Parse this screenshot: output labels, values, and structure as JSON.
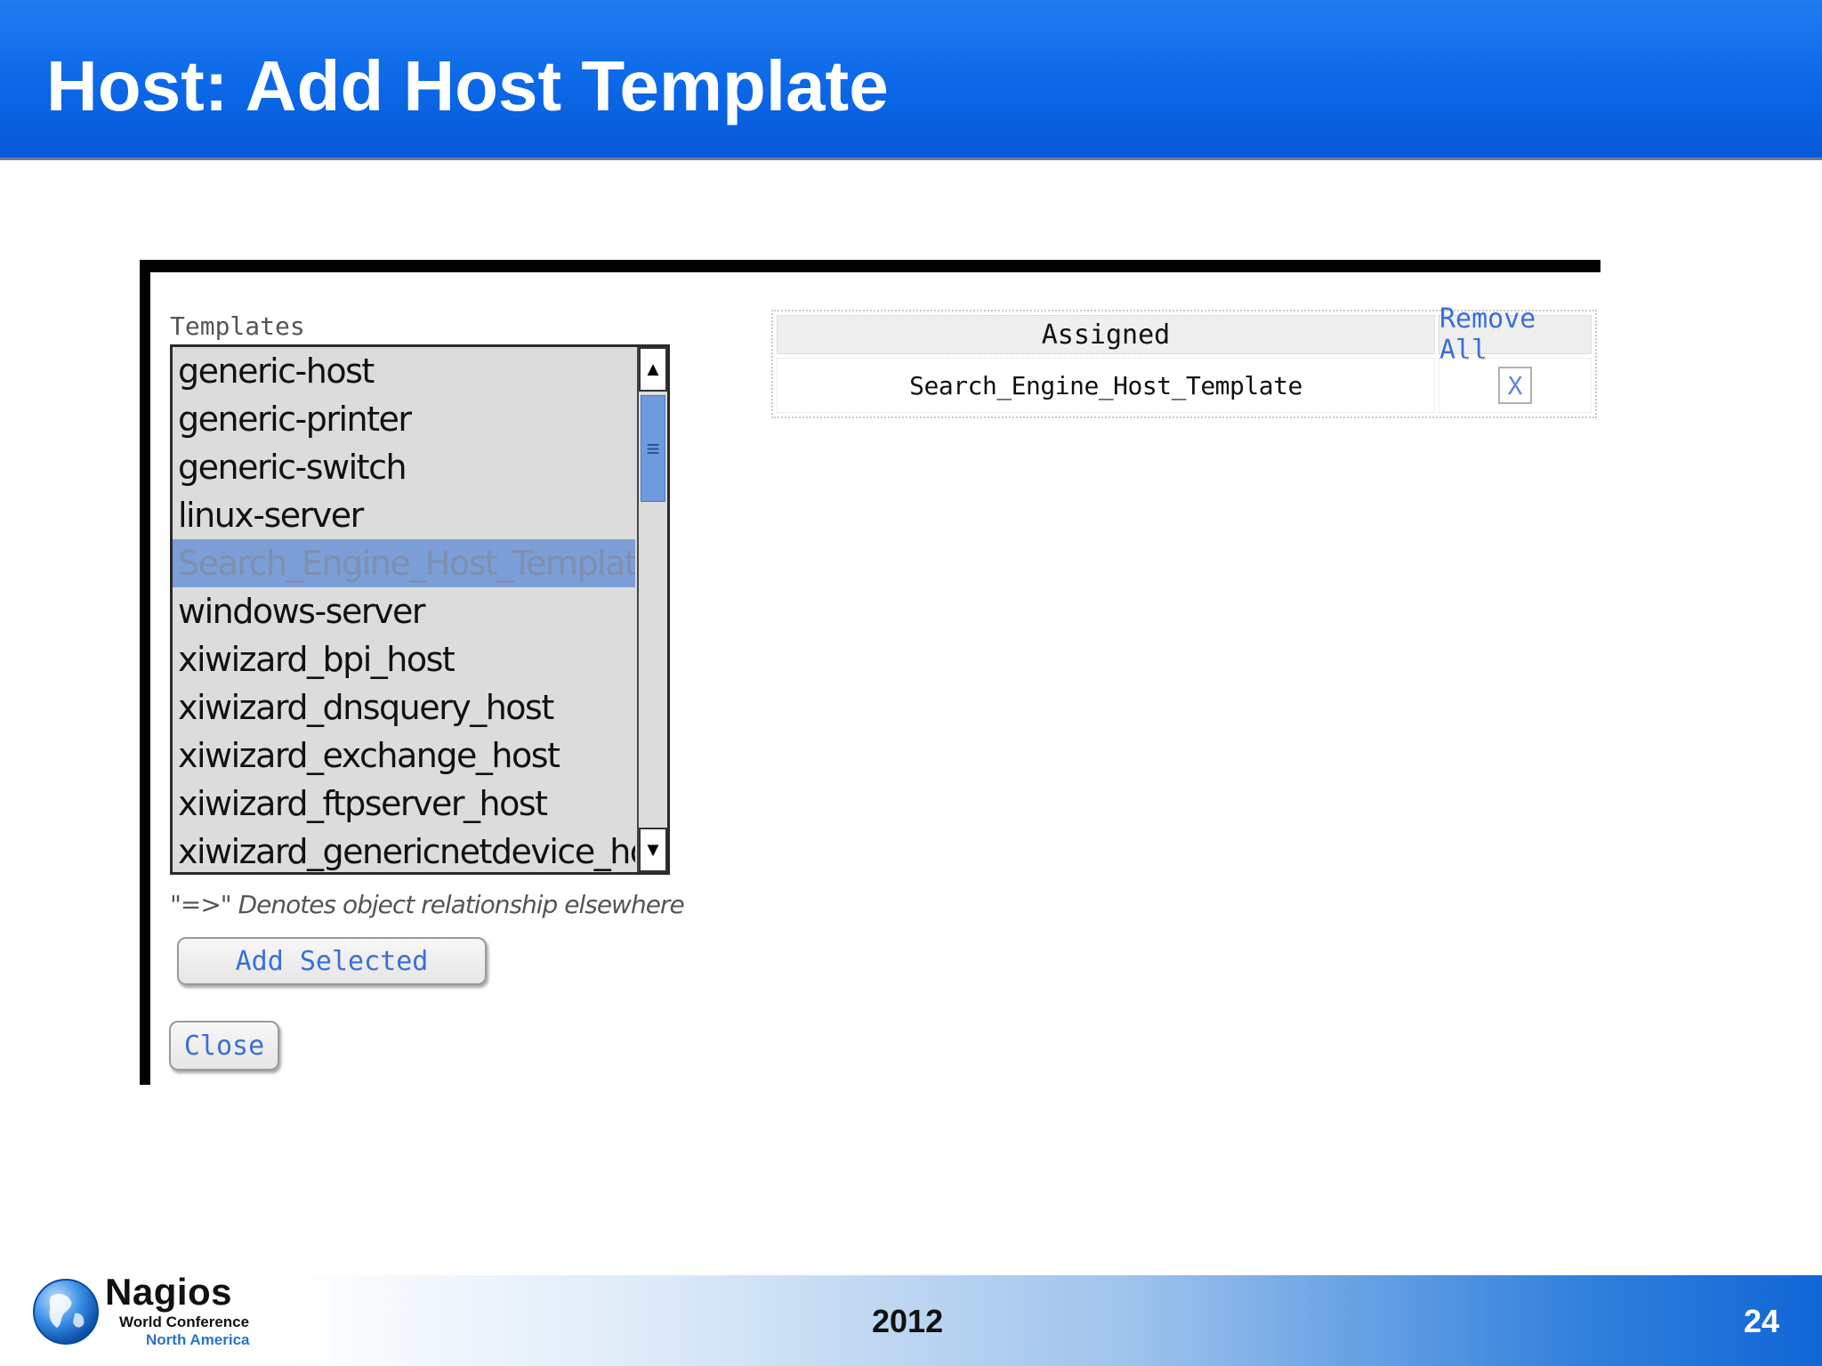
{
  "slide": {
    "title": "Host: Add Host Template",
    "footer_year": "2012",
    "page_number": "24"
  },
  "logo": {
    "name": "Nagios",
    "line1": "World Conference",
    "line2": "North America"
  },
  "templates_panel": {
    "label": "Templates",
    "items": [
      {
        "label": "generic-host",
        "selected": false
      },
      {
        "label": "generic-printer",
        "selected": false
      },
      {
        "label": "generic-switch",
        "selected": false
      },
      {
        "label": "linux-server",
        "selected": false
      },
      {
        "label": "Search_Engine_Host_Template",
        "selected": true
      },
      {
        "label": "windows-server",
        "selected": false
      },
      {
        "label": "xiwizard_bpi_host",
        "selected": false
      },
      {
        "label": "xiwizard_dnsquery_host",
        "selected": false
      },
      {
        "label": "xiwizard_exchange_host",
        "selected": false
      },
      {
        "label": "xiwizard_ftpserver_host",
        "selected": false
      },
      {
        "label": "xiwizard_genericnetdevice_host",
        "selected": false
      }
    ],
    "note_prefix": "\"=>\"",
    "note_text": "Denotes object relationship elsewhere",
    "add_button": "Add Selected",
    "close_button": "Close"
  },
  "assigned_panel": {
    "header_assigned": "Assigned",
    "header_remove_all": "Remove All",
    "rows": [
      {
        "name": "Search_Engine_Host_Template",
        "remove": "X"
      }
    ]
  },
  "colors": {
    "header_blue": "#0a66e6",
    "link_blue": "#3a6fd8",
    "selected_row": "#7b9fd6"
  },
  "icons": {
    "scroll_up": "arrow-up-icon",
    "scroll_down": "arrow-down-icon",
    "scroll_grip": "grip-lines-icon",
    "globe": "globe-icon"
  }
}
